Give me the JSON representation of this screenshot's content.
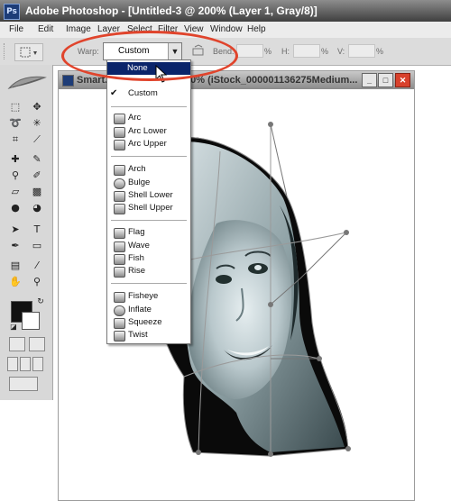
{
  "window": {
    "title": "Adobe Photoshop - [Untitled-3 @ 200% (Layer 1, Gray/8)]"
  },
  "menubar": {
    "items": [
      "File",
      "Edit",
      "Image",
      "Layer",
      "Select",
      "Filter",
      "View",
      "Window",
      "Help"
    ]
  },
  "options_bar": {
    "warp_label": "Warp:",
    "warp_value": "Custom",
    "bend_label": "Bend:",
    "bend_unit": "%",
    "h_label": "H:",
    "h_unit": "%",
    "v_label": "V:",
    "v_unit": "%"
  },
  "document": {
    "title": "Smart...",
    "title_tail": "00% (iStock_000001136275Medium..."
  },
  "warp_menu": {
    "items": [
      {
        "label": "None",
        "selected": true
      },
      {
        "label": "Custom",
        "checked": true
      },
      {
        "label": "Arc"
      },
      {
        "label": "Arc Lower"
      },
      {
        "label": "Arc Upper"
      },
      {
        "label": "Arch"
      },
      {
        "label": "Bulge"
      },
      {
        "label": "Shell Lower"
      },
      {
        "label": "Shell Upper"
      },
      {
        "label": "Flag"
      },
      {
        "label": "Wave"
      },
      {
        "label": "Fish"
      },
      {
        "label": "Rise"
      },
      {
        "label": "Fisheye"
      },
      {
        "label": "Inflate"
      },
      {
        "label": "Squeeze"
      },
      {
        "label": "Twist"
      }
    ],
    "check_glyph": "✔"
  },
  "colors": {
    "highlight_ring": "#e0442c",
    "menu_selection": "#0a246a"
  }
}
